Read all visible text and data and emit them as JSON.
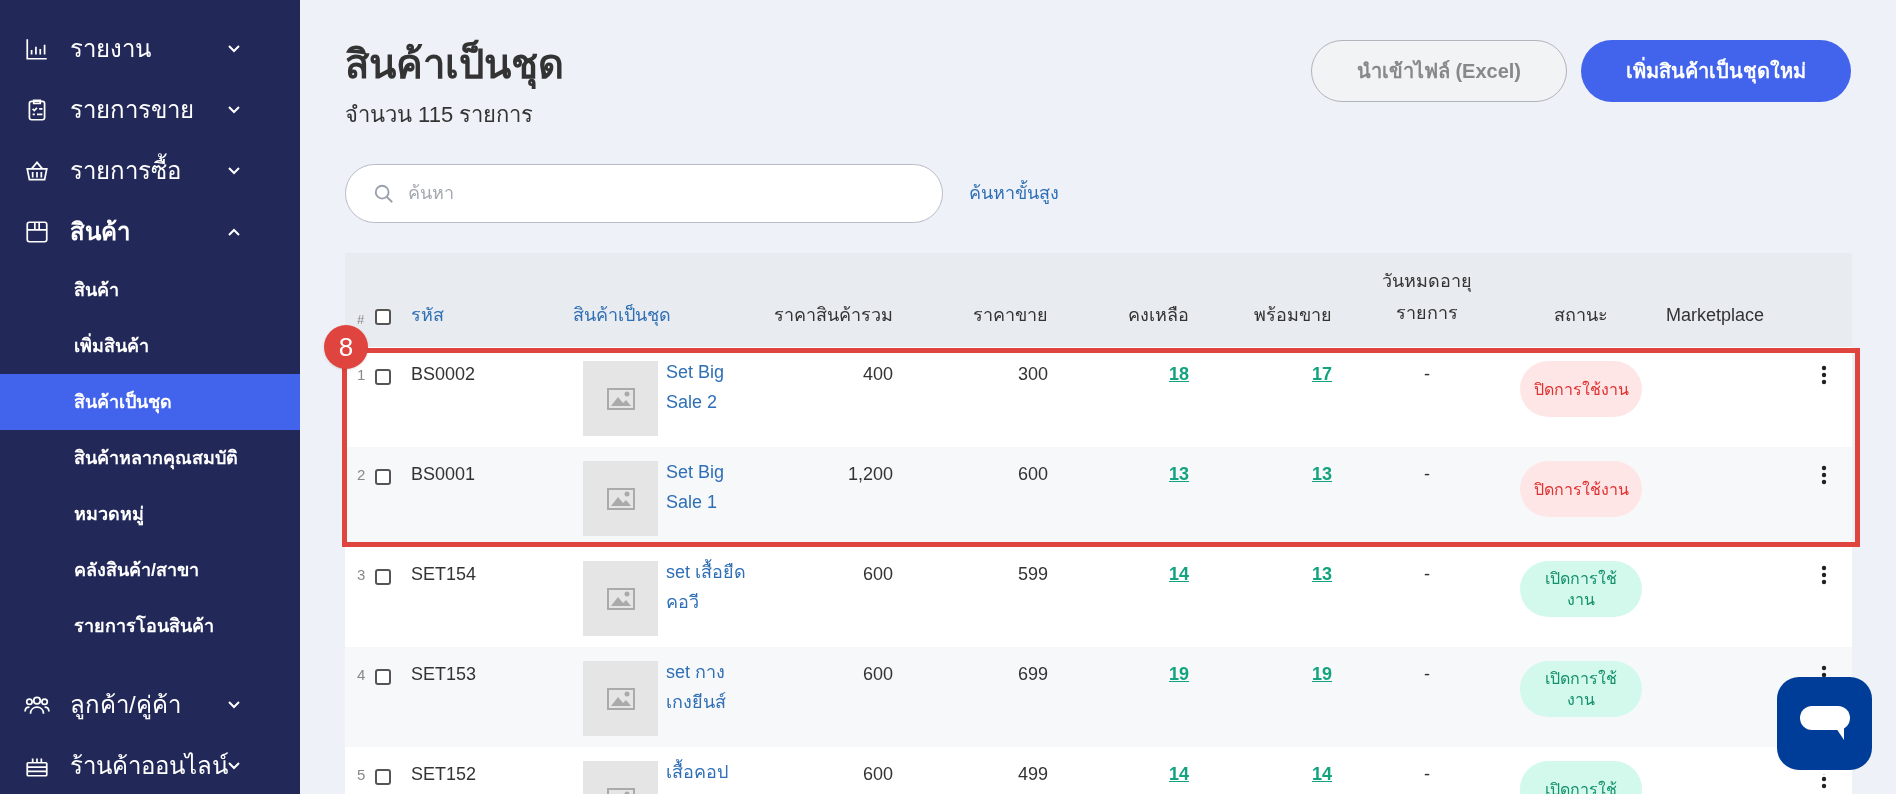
{
  "sidebar": {
    "items": [
      {
        "label": "รายงาน",
        "expanded": false
      },
      {
        "label": "รายการขาย",
        "expanded": false
      },
      {
        "label": "รายการซื้อ",
        "expanded": false
      },
      {
        "label": "สินค้า",
        "expanded": true,
        "children": [
          {
            "label": "สินค้า",
            "selected": false
          },
          {
            "label": "เพิ่มสินค้า",
            "selected": false
          },
          {
            "label": "สินค้าเป็นชุด",
            "selected": true
          },
          {
            "label": "สินค้าหลากคุณสมบัติ",
            "selected": false
          },
          {
            "label": "หมวดหมู่",
            "selected": false
          },
          {
            "label": "คลังสินค้า/สาขา",
            "selected": false
          },
          {
            "label": "รายการโอนสินค้า",
            "selected": false
          }
        ]
      },
      {
        "label": "ลูกค้า/คู่ค้า",
        "expanded": false
      },
      {
        "label": "ร้านค้าออนไลน์",
        "expanded": false
      }
    ]
  },
  "page": {
    "title": "สินค้าเป็นชุด",
    "count": "จำนวน 115 รายการ",
    "buttons": [
      {
        "label": "นำเข้าไฟล์ (Excel)",
        "kind": "secondary"
      },
      {
        "label": "เพิ่มสินค้าเป็นชุดใหม่",
        "kind": "primary"
      }
    ]
  },
  "search": {
    "placeholder": "ค้นหา",
    "advanced_link": "ค้นหาขั้นสูง"
  },
  "table": {
    "select_all_checked": false,
    "columns": [
      "#",
      "รหัส",
      "สินค้าเป็นชุด",
      "ราคาสินค้ารวม",
      "ราคาขาย",
      "คงเหลือ",
      "พร้อมขาย",
      "วันหมดอายุ\nรายการ",
      "สถานะ",
      "Marketplace"
    ],
    "rows": [
      {
        "index": "1",
        "checked": false,
        "code": "BS0002",
        "name": "Set Big Sale 2",
        "total_price": "400",
        "price": "300",
        "stock": "18",
        "ready": "17",
        "expiry": "-",
        "status": "ปิดการใช้งาน",
        "active": false
      },
      {
        "index": "2",
        "checked": false,
        "code": "BS0001",
        "name": "Set Big Sale 1",
        "total_price": "1,200",
        "price": "600",
        "stock": "13",
        "ready": "13",
        "expiry": "-",
        "status": "ปิดการใช้งาน",
        "active": false
      },
      {
        "index": "3",
        "checked": false,
        "code": "SET154",
        "name": "set เสื้อยืดคอวี",
        "total_price": "600",
        "price": "599",
        "stock": "14",
        "ready": "13",
        "expiry": "-",
        "status": "เปิดการใช้งาน",
        "active": true
      },
      {
        "index": "4",
        "checked": false,
        "code": "SET153",
        "name": "set กางเกงยีนส์",
        "total_price": "600",
        "price": "699",
        "stock": "19",
        "ready": "19",
        "expiry": "-",
        "status": "เปิดการใช้งาน",
        "active": true
      },
      {
        "index": "5",
        "checked": false,
        "code": "SET152",
        "name": "เสื้อคอป",
        "total_price": "600",
        "price": "499",
        "stock": "14",
        "ready": "14",
        "expiry": "-",
        "status": "เปิดการใช้",
        "active": true
      }
    ]
  },
  "annotation": {
    "label": "8"
  }
}
